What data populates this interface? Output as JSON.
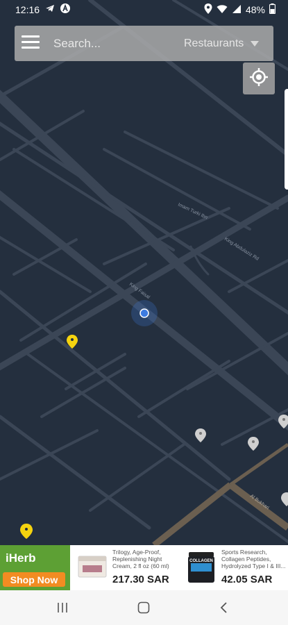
{
  "status": {
    "time": "12:16",
    "battery": "48%",
    "left_icons": [
      "telegram-icon",
      "circle-a-icon"
    ],
    "right_icons": [
      "location-icon",
      "wifi-icon",
      "signal-icon",
      "battery-icon"
    ]
  },
  "search": {
    "placeholder": "Search...",
    "category": "Restaurants"
  },
  "map": {
    "theme_colors": {
      "background": "#242f3e",
      "road": "#3b4656",
      "major_road": "#6b5f50",
      "pin_yellow": "#f5d30f",
      "pin_grey": "#cfcfcf",
      "user_dot": "#3d7be0"
    },
    "street_labels": [
      "King Faisal",
      "King Abdulaziz Rd",
      "Imam Turki Ibn",
      "Al Bukhari"
    ]
  },
  "ad": {
    "brand": "iHerb",
    "cta": "Shop Now",
    "products": [
      {
        "name": "Trilogy, Age-Proof, Replenishing Night Cream, 2 fl oz (60 ml)",
        "price": "217.30 SAR",
        "image_label": ""
      },
      {
        "name": "Sports Research, Collagen Peptides, Hydrolyzed Type I & III...",
        "price": "42.05 SAR",
        "image_label": "COLLAGEN"
      }
    ]
  },
  "navbar": {
    "icons": [
      "recent-apps-icon",
      "home-icon",
      "back-icon"
    ]
  }
}
